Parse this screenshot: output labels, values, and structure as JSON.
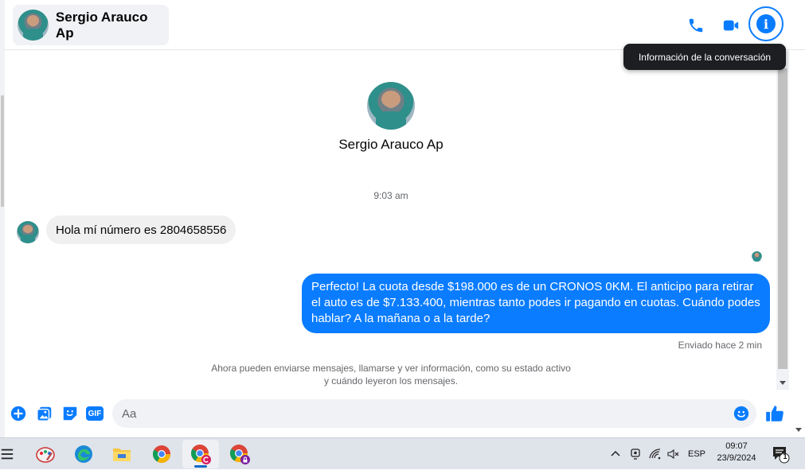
{
  "header": {
    "contact_name": "Sergio Arauco Ap",
    "phone_icon": "phone-icon",
    "video_icon": "video-camera-icon",
    "info_icon": "info-icon"
  },
  "tooltip": {
    "text": "Información de la conversación"
  },
  "thread": {
    "profile_name": "Sergio Arauco Ap",
    "timestamp": "9:03 am",
    "messages": [
      {
        "direction": "incoming",
        "text": "Hola mí número es 2804658556"
      },
      {
        "direction": "outgoing",
        "text": "Perfecto! La cuota desde $198.000 es de un CRONOS 0KM. El anticipo para retirar el auto es de $7.133.400, mientras tanto podes ir pagando en cuotas. Cuándo podes hablar? A la mañana o a la tarde?"
      }
    ],
    "sent_status": "Enviado hace 2 min",
    "privacy_note": "Ahora pueden enviarse mensajes, llamarse y ver información, como su estado activo y cuándo leyeron los mensajes."
  },
  "composer": {
    "placeholder": "Aa",
    "gif_label": "GIF",
    "icons": [
      "plus-icon",
      "gallery-icon",
      "sticker-icon",
      "gif-icon",
      "emoji-icon",
      "thumbs-up-icon"
    ]
  },
  "taskbar": {
    "apps": [
      "task-view-icon",
      "paint-icon",
      "edge-icon",
      "file-explorer-icon",
      "chrome-icon",
      "chrome-profile-c-icon",
      "chrome-profile-lock-icon"
    ],
    "language": "ESP",
    "time": "09:07",
    "date": "23/9/2024",
    "notification_count": "1"
  },
  "colors": {
    "accent": "#0a7cff",
    "incoming_bubble": "#f0f0f0",
    "tooltip_bg": "#1c1e21",
    "taskbar_bg": "#dfe3ea"
  }
}
